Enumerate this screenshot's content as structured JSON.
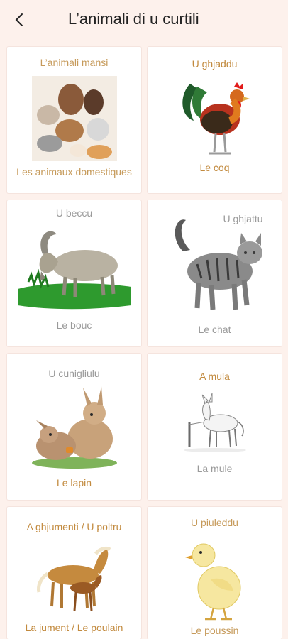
{
  "header": {
    "title": "L’animali di u curtili",
    "back_icon": "back-arrow-icon"
  },
  "cards": [
    {
      "top": "L’animali mansi",
      "bottom": "Les animaux domestiques",
      "icon": "domestic-animals-illustration"
    },
    {
      "top": "U ghjaddu",
      "bottom": "Le coq",
      "icon": "rooster-illustration"
    },
    {
      "top": "U beccu",
      "bottom": "Le bouc",
      "icon": "goat-illustration"
    },
    {
      "top": "U ghjattu",
      "bottom": "Le chat",
      "icon": "cat-illustration"
    },
    {
      "top": "U cunigliulu",
      "bottom": "Le lapin",
      "icon": "rabbit-illustration"
    },
    {
      "top": "A mula",
      "bottom": "La mule",
      "icon": "mule-illustration"
    },
    {
      "top": "A ghjumenti / U poltru",
      "bottom": "La jument / Le poulain",
      "icon": "horse-illustration"
    },
    {
      "top": "U piuleddu",
      "bottom": "Le poussin",
      "icon": "chick-illustration"
    }
  ],
  "colors": {
    "background": "#fdf1ec",
    "label_gold": "#c69a5a",
    "label_gray": "#9a9a9a"
  }
}
